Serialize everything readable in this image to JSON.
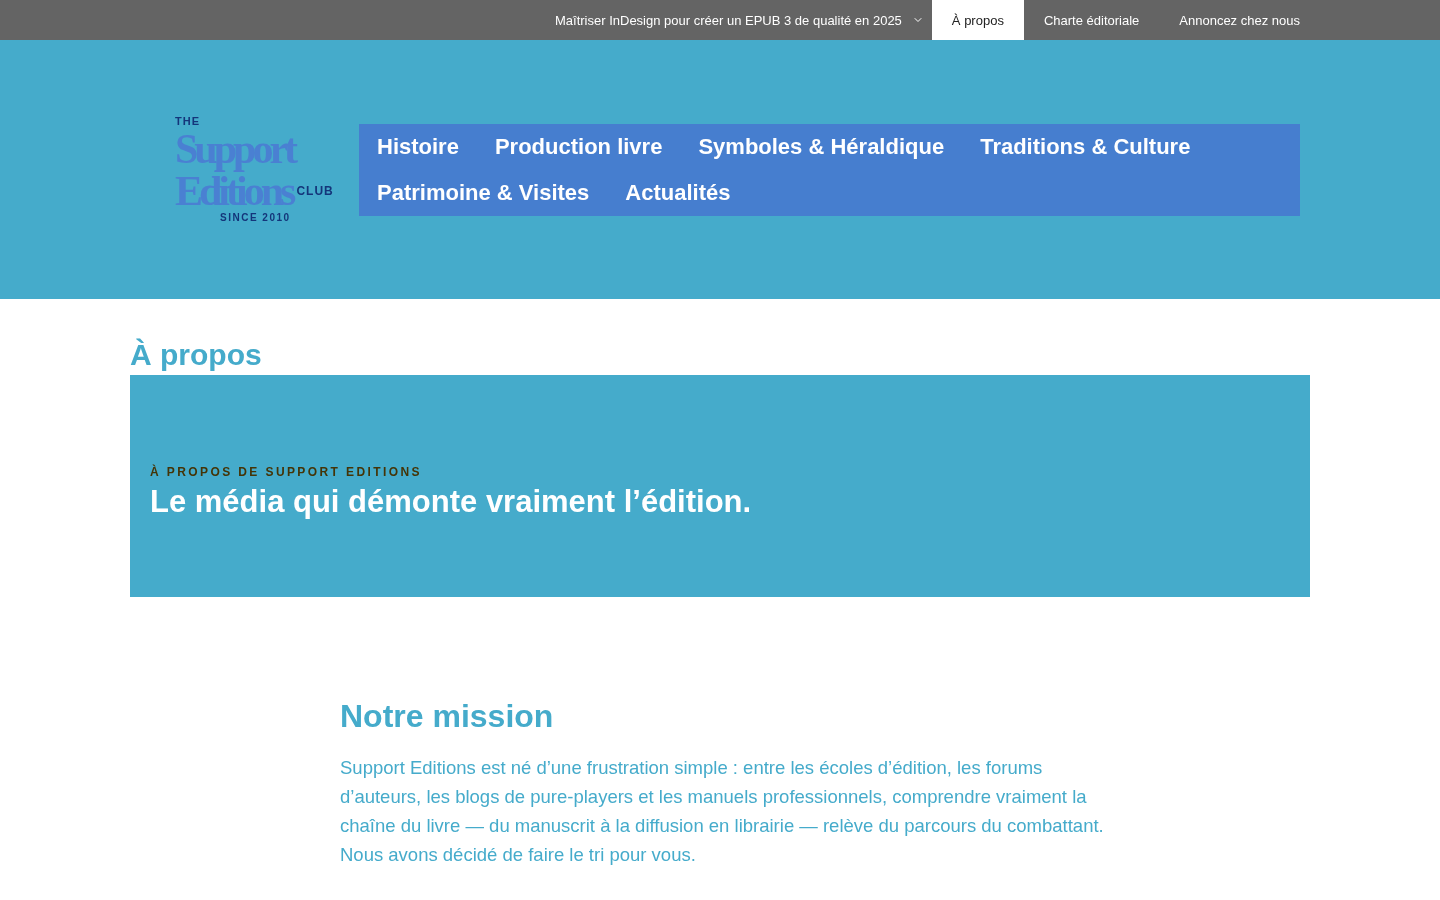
{
  "top_bar": {
    "items": [
      {
        "label": "Maîtriser InDesign pour créer un EPUB 3 de qualité en 2025",
        "selected": false,
        "dropdown": true
      },
      {
        "label": "À propos",
        "selected": true,
        "dropdown": false
      },
      {
        "label": "Charte éditoriale",
        "selected": false,
        "dropdown": false
      },
      {
        "label": "Annoncez chez nous",
        "selected": false,
        "dropdown": false
      }
    ]
  },
  "header": {
    "logo": {
      "top": "THE",
      "line_1": "Support",
      "line_2": "Editions",
      "badge": "CLUB",
      "tagline": "SINCE 2010"
    },
    "nav": [
      {
        "label": "Histoire"
      },
      {
        "label": "Production livre"
      },
      {
        "label": "Symboles & Héraldique"
      },
      {
        "label": "Traditions & Culture"
      },
      {
        "label": "Patrimoine & Visites"
      },
      {
        "label": "Actualités"
      }
    ]
  },
  "page_title": "À propos",
  "hero": {
    "eyebrow": "À PROPOS DE SUPPORT EDITIONS",
    "title": "Le média qui démonte vraiment l’édition."
  },
  "mission": {
    "heading": "Notre mission",
    "paragraph": "Support Editions est né d’une frustration simple : entre les écoles d’édition, les forums d’auteurs, les blogs de pure-players et les manuels professionnels, comprendre vraiment la chaîne du livre — du manuscrit à la diffusion en librairie — relève du parcours du combattant. Nous avons décidé de faire le tri pour vous."
  }
}
